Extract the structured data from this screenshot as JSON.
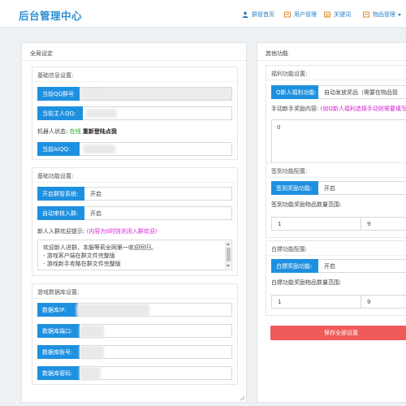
{
  "header": {
    "brand": "后台管理中心",
    "nav": [
      {
        "label": "群管首页",
        "icon": "user-icon"
      },
      {
        "label": "用户管理",
        "icon": "users-icon"
      },
      {
        "label": "关键词",
        "icon": "list-icon"
      },
      {
        "label": "物品管理",
        "icon": "box-icon",
        "dropdown": true
      }
    ]
  },
  "left_panel": {
    "title": "全局设定",
    "basic_info": {
      "title": "基础信息设置:",
      "current_group_label": "当前QQ群号",
      "current_owner_label": "当前主人QQ:",
      "robot_status_label": "机器人状态:",
      "robot_status_value": "在线",
      "robot_status_action": "重新登陆点我",
      "current_ai_label": "当前AIQQ:"
    },
    "basic_func": {
      "title": "基础功能设置:",
      "group_mgmt_label": "开启群管系统:",
      "group_mgmt_value": "开启",
      "auto_review_label": "自动审核入群:",
      "auto_review_value": "开启",
      "welcome_label": "新人入群欢迎提示:",
      "welcome_hint": "(内容为0时则关闭入群欢迎)",
      "welcome_lines": [
        "欢迎新人进群，本服等莉全网第一收迎回归。",
        "-    游戏客户端在群文件完整版",
        "-    游戏新手攻略在群文件完整版",
        "-    ..."
      ]
    },
    "db": {
      "title": "游戏数据库设置:",
      "ip_label": "数据库IP:",
      "port_label": "数据库端口:",
      "account_label": "数据库账号:",
      "password_label": "数据库密码:"
    }
  },
  "right_panel": {
    "title": "其他功能",
    "welfare": {
      "title": "福利功能设置:",
      "newbie_label": "Q新人福利功能:",
      "newbie_value": "自动发放奖品（需要在物品管",
      "manual_label": "手动新手奖励内容:",
      "manual_hint": "(如Q新人福利选择手动则需要填写",
      "manual_value": "0"
    },
    "signin": {
      "title": "签到功能配置:",
      "reward_label": "签到奖励功能:",
      "reward_value": "开启",
      "range_label": "签到功能奖励物品数量范围:",
      "min": "1",
      "max": "9"
    },
    "whiteboard": {
      "title": "白嫖功能配置:",
      "reward_label": "白嫖奖励功能:",
      "reward_value": "开启",
      "range_label": "白嫖功能奖励物品数量范围:",
      "min": "1",
      "max": "9"
    },
    "save_label": "保存全部设置"
  },
  "colors": {
    "accent": "#1e90e0",
    "brand": "#2b8fd6",
    "save": "#f05a5a",
    "hint": "#d61fd6",
    "online": "#22a722"
  }
}
